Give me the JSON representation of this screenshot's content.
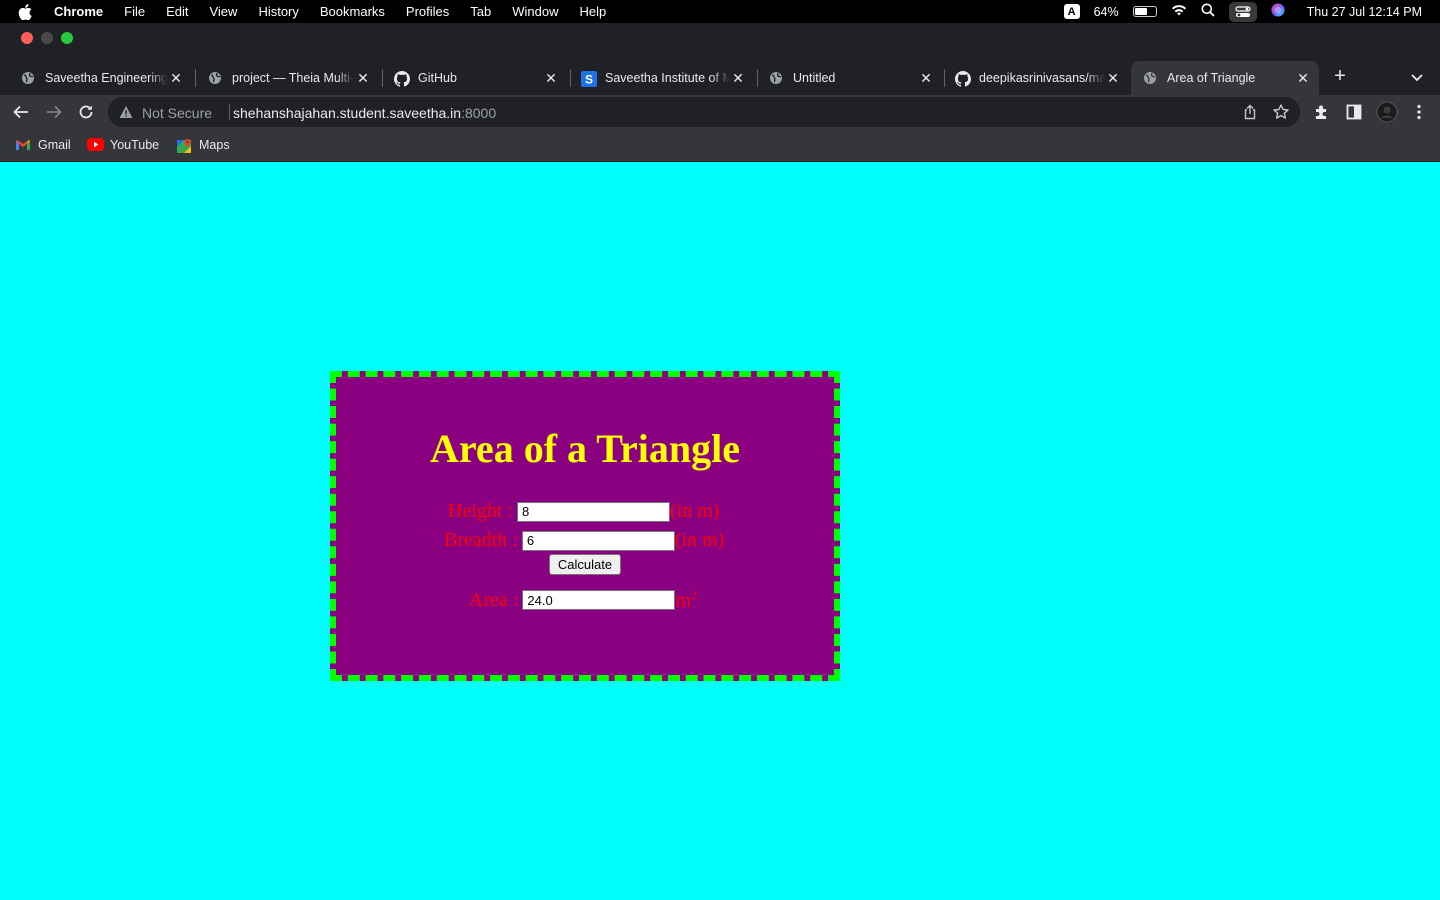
{
  "menubar": {
    "app": "Chrome",
    "items": [
      "File",
      "Edit",
      "View",
      "History",
      "Bookmarks",
      "Profiles",
      "Tab",
      "Window",
      "Help"
    ],
    "input_badge": "A",
    "battery": "64%",
    "battery_level": 0.64,
    "datetime": "Thu 27 Jul  12:14 PM"
  },
  "tabs": [
    {
      "title": "Saveetha Engineering College",
      "icon": "globe-icon"
    },
    {
      "title": "project — Theia Multi-Language",
      "icon": "globe-icon"
    },
    {
      "title": "GitHub",
      "icon": "github-icon"
    },
    {
      "title": "Saveetha Institute of Medical",
      "icon": "saveetha-s-icon"
    },
    {
      "title": "Untitled",
      "icon": "globe-icon"
    },
    {
      "title": "deepikasrinivasans/mathematical",
      "icon": "github-icon"
    },
    {
      "title": "Area of Triangle",
      "icon": "globe-icon",
      "active": true
    }
  ],
  "omnibox": {
    "security": "Not Secure",
    "host": "shehanshajahan.student.saveetha.in",
    "port": ":8000"
  },
  "bookmarks": [
    {
      "label": "Gmail",
      "icon": "gmail-icon"
    },
    {
      "label": "YouTube",
      "icon": "youtube-icon"
    },
    {
      "label": "Maps",
      "icon": "maps-icon"
    }
  ],
  "page": {
    "heading": "Area of a Triangle",
    "height_label": "Height :",
    "height_value": "8",
    "height_unit": "(in m)",
    "breadth_label": "Breadth :",
    "breadth_value": "6",
    "breadth_unit": "(in m)",
    "calculate_label": "Calculate",
    "area_label": "Area :",
    "area_value": "24.0",
    "area_unit": "m",
    "area_unit_sup": "2"
  },
  "colors": {
    "page_bg": "#00ffff",
    "panel_bg": "#8b0081",
    "panel_border": "#00ff00",
    "heading": "#ffff00",
    "label": "#ff0000"
  }
}
